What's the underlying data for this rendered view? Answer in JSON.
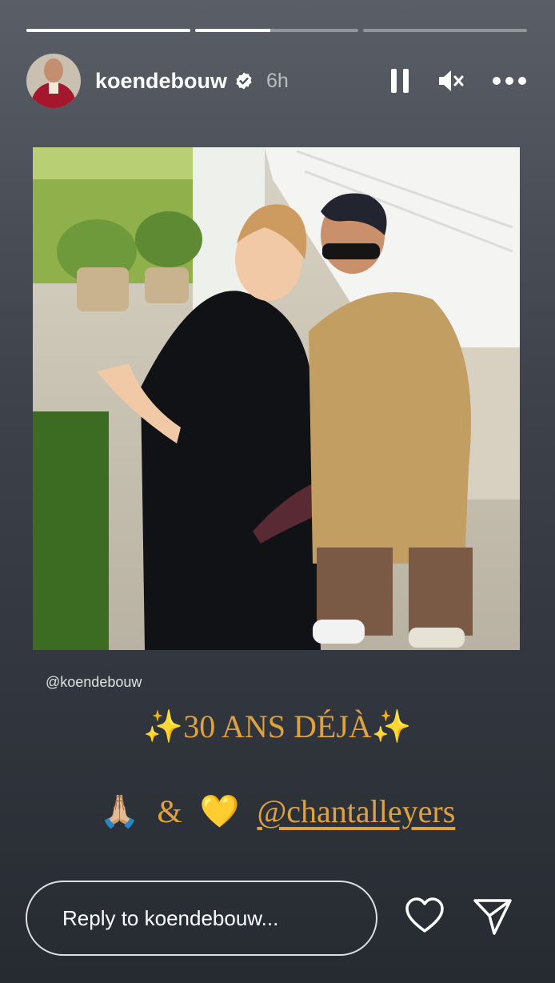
{
  "story": {
    "progress": [
      1.0,
      0.46,
      0.0
    ],
    "username": "koendebouw",
    "time": "6h",
    "mention_tag": "@koendebouw",
    "caption_line1": "✨30 ANS DÉJÀ✨",
    "caption_emoji_pray": "🙏🏼",
    "caption_amp": "&",
    "caption_emoji_heart": "💛",
    "caption_mention": "@chantalleyers"
  },
  "icons": {
    "verified": "verified-badge-icon",
    "pause": "pause-icon",
    "mute": "muted-speaker-icon",
    "more": "more-options-icon",
    "like": "heart-icon",
    "send": "send-icon"
  },
  "reply": {
    "placeholder": "Reply to koendebouw..."
  },
  "colors": {
    "caption": "#e0a23c",
    "verified": "#ffffff"
  }
}
